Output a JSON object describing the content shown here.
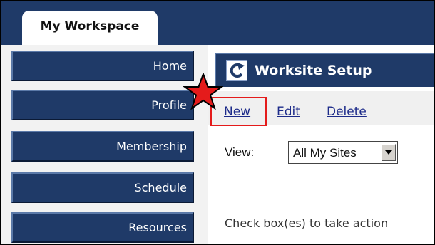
{
  "workspace_tab": {
    "label": "My Workspace"
  },
  "sidebar": {
    "items": [
      {
        "label": "Home"
      },
      {
        "label": "Profile"
      },
      {
        "label": "Membership"
      },
      {
        "label": "Schedule"
      },
      {
        "label": "Resources"
      }
    ]
  },
  "tool": {
    "title": "Worksite Setup",
    "reset_icon": "reset-arrow-icon"
  },
  "actions": {
    "new_label": "New",
    "edit_label": "Edit",
    "delete_label": "Delete",
    "highlighted": "New"
  },
  "annotation": {
    "marker_icon": "red-star-icon",
    "highlight_color": "#e41b1b"
  },
  "view": {
    "label": "View:",
    "selected": "All My Sites"
  },
  "instruction": "Check box(es) to take action",
  "colors": {
    "nav_blue": "#1f3a68",
    "link_blue": "#1d2b8a",
    "action_bar_bg": "#f0f0f0",
    "sidebar_bg": "#f2f2f2"
  }
}
